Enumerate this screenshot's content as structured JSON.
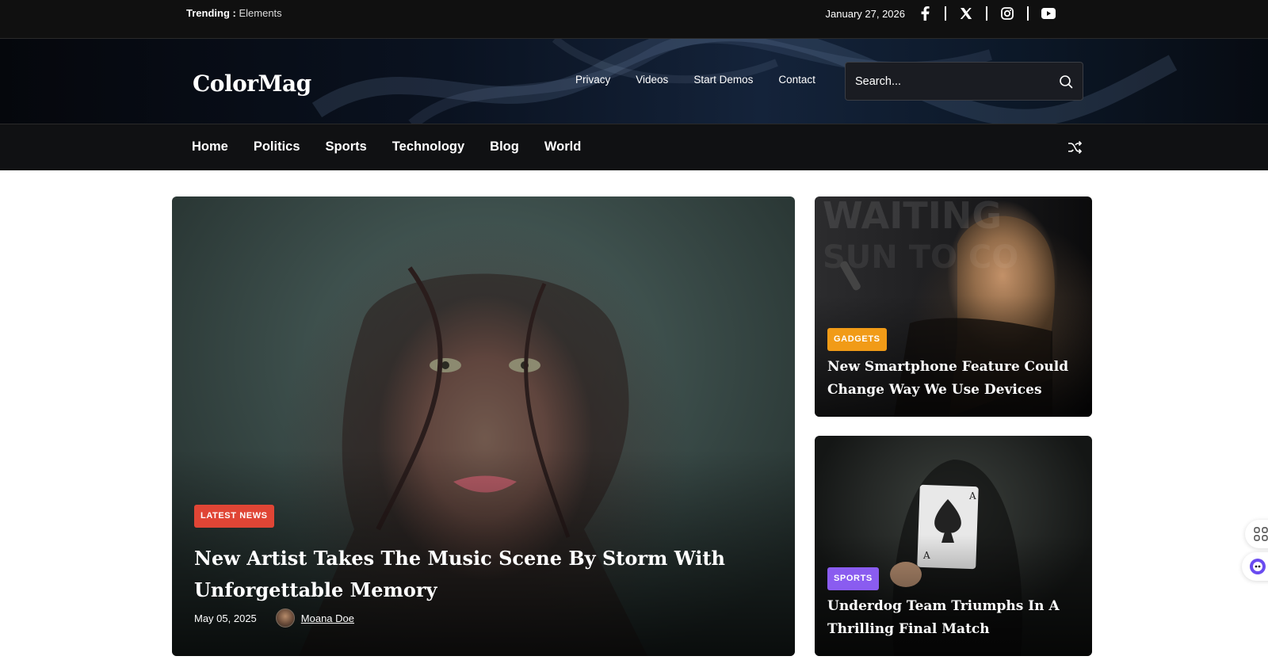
{
  "topbar": {
    "trending_label": "Trending :",
    "trending_link": "Elements",
    "date": "January 27, 2026",
    "social": [
      "facebook-icon",
      "x-twitter-icon",
      "instagram-icon",
      "youtube-icon"
    ]
  },
  "header": {
    "logo": "ColorMag",
    "nav": [
      "Privacy",
      "Videos",
      "Start Demos",
      "Contact"
    ],
    "search": {
      "placeholder": "Search..."
    }
  },
  "mainnav": {
    "items": [
      "Home",
      "Politics",
      "Sports",
      "Technology",
      "Blog",
      "World"
    ]
  },
  "featured": {
    "badge": "LATEST NEWS",
    "title": "New Artist Takes The Music Scene By Storm With Unforgettable Memory",
    "date": "May 05, 2025",
    "author": "Moana Doe"
  },
  "side_posts": [
    {
      "badge": "GADGETS",
      "title": "New Smartphone Feature Could Change Way We Use Devices"
    },
    {
      "badge": "SPORTS",
      "title": "Underdog Team Triumphs In A Thrilling Final Match"
    }
  ],
  "colors": {
    "badge_latest": "#e04535",
    "badge_gadgets": "#f19b17",
    "badge_sports": "#8a5cf0"
  }
}
